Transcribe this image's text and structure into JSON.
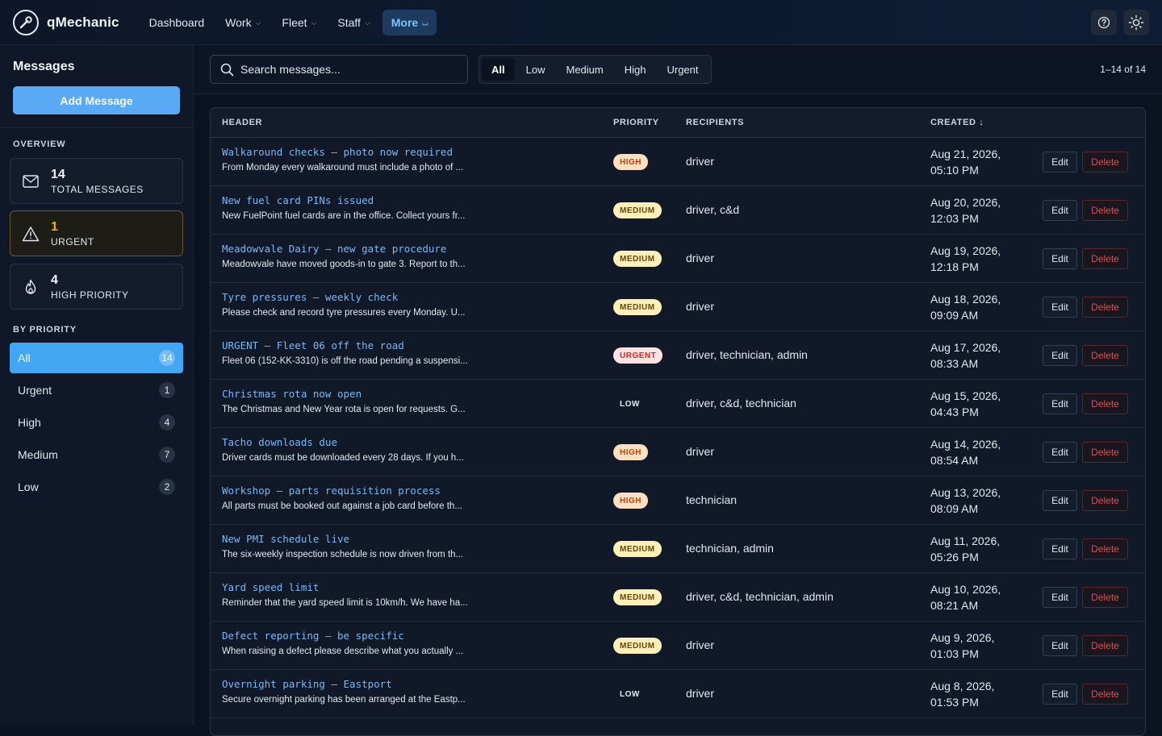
{
  "app": {
    "name": "qMechanic"
  },
  "nav": [
    {
      "label": "Dashboard",
      "has_dropdown": false,
      "active": false
    },
    {
      "label": "Work",
      "has_dropdown": true,
      "active": false
    },
    {
      "label": "Fleet",
      "has_dropdown": true,
      "active": false
    },
    {
      "label": "Staff",
      "has_dropdown": true,
      "active": false
    },
    {
      "label": "More",
      "has_dropdown": true,
      "active": true
    }
  ],
  "top_icons": [
    "help-circle-icon",
    "sun-icon"
  ],
  "sidebar": {
    "title": "Messages",
    "add_button": "Add Message",
    "overview_label": "OVERVIEW",
    "stats": [
      {
        "value": "14",
        "label": "TOTAL MESSAGES",
        "icon": "mail-icon"
      },
      {
        "value": "1",
        "label": "URGENT",
        "icon": "alert-triangle-icon"
      },
      {
        "value": "4",
        "label": "HIGH PRIORITY",
        "icon": "flame-icon"
      }
    ],
    "by_priority_label": "BY PRIORITY",
    "priorities": [
      {
        "label": "All",
        "count": "14",
        "active": true
      },
      {
        "label": "Urgent",
        "count": "1",
        "active": false
      },
      {
        "label": "High",
        "count": "4",
        "active": false
      },
      {
        "label": "Medium",
        "count": "7",
        "active": false
      },
      {
        "label": "Low",
        "count": "2",
        "active": false
      }
    ]
  },
  "toolbar": {
    "search_placeholder": "Search messages...",
    "filters": [
      "All",
      "Low",
      "Medium",
      "High",
      "Urgent"
    ],
    "active_filter": "All",
    "range_text": "1–14 of 14"
  },
  "table": {
    "columns": {
      "header": "HEADER",
      "priority": "PRIORITY",
      "recipients": "RECIPIENTS",
      "created": "CREATED",
      "sort_indicator": "↓"
    },
    "edit_label": "Edit",
    "delete_label": "Delete",
    "rows": [
      {
        "title": "Walkaround checks – photo now required",
        "body": "From Monday every walkaround must include a photo of ...",
        "priority": "HIGH",
        "recipients": "driver",
        "date": "Aug 21, 2026,",
        "time": "05:10 PM"
      },
      {
        "title": "New fuel card PINs issued",
        "body": "New FuelPoint fuel cards are in the office. Collect yours fr...",
        "priority": "MEDIUM",
        "recipients": "driver, c&d",
        "date": "Aug 20, 2026,",
        "time": "12:03 PM"
      },
      {
        "title": "Meadowvale Dairy – new gate procedure",
        "body": "Meadowvale have moved goods-in to gate 3. Report to th...",
        "priority": "MEDIUM",
        "recipients": "driver",
        "date": "Aug 19, 2026,",
        "time": "12:18 PM"
      },
      {
        "title": "Tyre pressures – weekly check",
        "body": "Please check and record tyre pressures every Monday. U...",
        "priority": "MEDIUM",
        "recipients": "driver",
        "date": "Aug 18, 2026,",
        "time": "09:09 AM"
      },
      {
        "title": "URGENT – Fleet 06 off the road",
        "body": "Fleet 06 (152-KK-3310) is off the road pending a suspensi...",
        "priority": "URGENT",
        "recipients": "driver, technician, admin",
        "date": "Aug 17, 2026,",
        "time": "08:33 AM"
      },
      {
        "title": "Christmas rota now open",
        "body": "The Christmas and New Year rota is open for requests. G...",
        "priority": "LOW",
        "recipients": "driver, c&d, technician",
        "date": "Aug 15, 2026,",
        "time": "04:43 PM"
      },
      {
        "title": "Tacho downloads due",
        "body": "Driver cards must be downloaded every 28 days. If you h...",
        "priority": "HIGH",
        "recipients": "driver",
        "date": "Aug 14, 2026,",
        "time": "08:54 AM"
      },
      {
        "title": "Workshop – parts requisition process",
        "body": "All parts must be booked out against a job card before th...",
        "priority": "HIGH",
        "recipients": "technician",
        "date": "Aug 13, 2026,",
        "time": "08:09 AM"
      },
      {
        "title": "New PMI schedule live",
        "body": "The six-weekly inspection schedule is now driven from th...",
        "priority": "MEDIUM",
        "recipients": "technician, admin",
        "date": "Aug 11, 2026,",
        "time": "05:26 PM"
      },
      {
        "title": "Yard speed limit",
        "body": "Reminder that the yard speed limit is 10km/h. We have ha...",
        "priority": "MEDIUM",
        "recipients": "driver, c&d, technician, admin",
        "date": "Aug 10, 2026,",
        "time": "08:21 AM"
      },
      {
        "title": "Defect reporting – be specific",
        "body": "When raising a defect please describe what you actually ...",
        "priority": "MEDIUM",
        "recipients": "driver",
        "date": "Aug 9, 2026,",
        "time": "01:03 PM"
      },
      {
        "title": "Overnight parking – Eastport",
        "body": "Secure overnight parking has been arranged at the Eastp...",
        "priority": "LOW",
        "recipients": "driver",
        "date": "Aug 8, 2026,",
        "time": "01:53 PM"
      }
    ]
  }
}
